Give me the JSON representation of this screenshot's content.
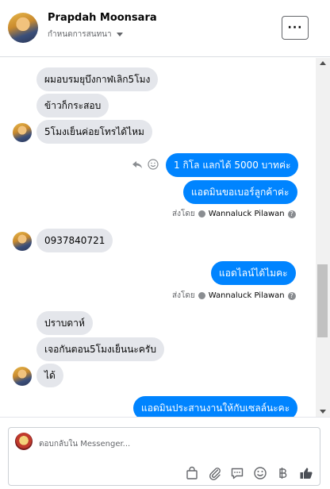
{
  "header": {
    "contact_name": "Prapdah Moonsara",
    "subtitle": "กำหนดการสนทนา",
    "menu_label": "···"
  },
  "messages": {
    "m1": "ผมอบรมยุบึงกาฬเลิก5โมง",
    "m2": "ข้าวก็กระสอบ",
    "m3": "5โมงเย็นค่อยโทรได้ไหม",
    "m4": "1 กิโล แลกได้ 5000 บาทค่ะ",
    "m5": "แอดมินขอเบอร์ลูกค้าค่ะ",
    "m6": "0937840721",
    "m7": "แอดไลน์ได้ไมคะ",
    "m8": "ปราบดาห์",
    "m9": "เจอกันตอน5โมงเย็นนะครับ",
    "m10": "ได้",
    "m11": "แอดมินประสานงานให้กับเซลล์นะคะ"
  },
  "sent_by": {
    "label": "ส่งโดย",
    "agent": "Wannaluck Pilawan"
  },
  "composer": {
    "placeholder": "ตอบกลับใน Messenger..."
  },
  "colors": {
    "outgoing_bubble": "#0084ff",
    "incoming_bubble": "#e4e6eb"
  },
  "icons": [
    "reply-icon",
    "smiley-icon",
    "shopping-bag-icon",
    "paperclip-icon",
    "chat-bubble-icon",
    "emoji-icon",
    "baht-icon",
    "thumbs-up-icon"
  ]
}
